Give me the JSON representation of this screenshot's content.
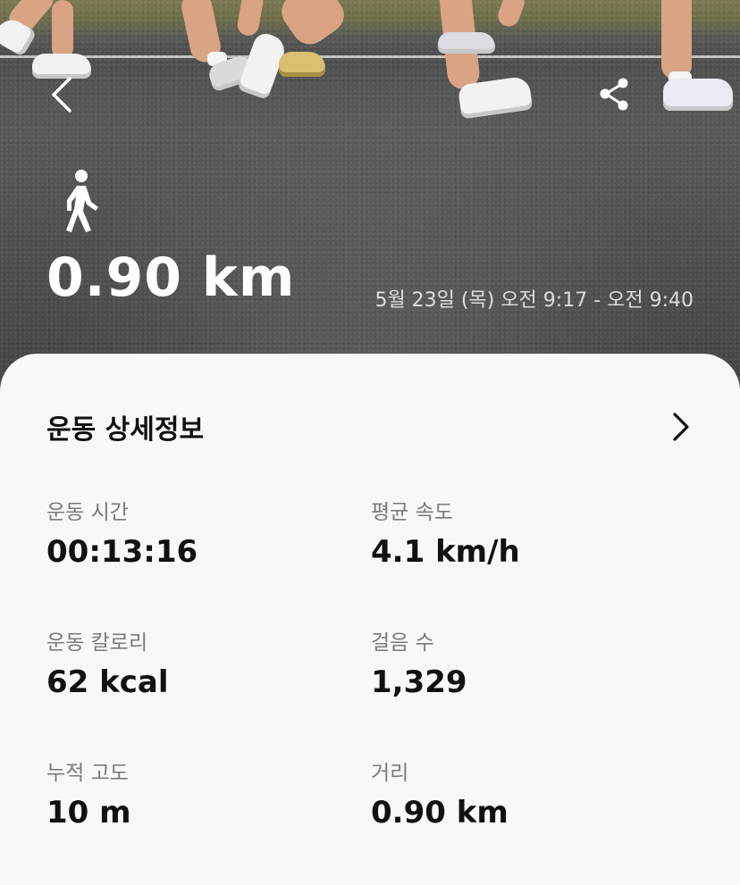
{
  "hero": {
    "distance": "0.90 km",
    "date_range": "5월 23일 (목) 오전 9:17 - 오전 9:40",
    "back_icon": "chevron-left-icon",
    "share_icon": "share-icon",
    "activity_icon": "walking-person-icon"
  },
  "details": {
    "title": "운동 상세정보",
    "more_icon": "chevron-right-icon",
    "stats": [
      {
        "label": "운동 시간",
        "value": "00:13:16"
      },
      {
        "label": "평균 속도",
        "value": "4.1 km/h"
      },
      {
        "label": "운동 칼로리",
        "value": "62 kcal"
      },
      {
        "label": "걸음 수",
        "value": "1,329"
      },
      {
        "label": "누적 고도",
        "value": "10 m"
      },
      {
        "label": "거리",
        "value": "0.90 km"
      }
    ]
  },
  "colors": {
    "card_background": "#f8f8fa",
    "text_primary": "#111111",
    "text_secondary": "#7a7a7a",
    "hero_text": "#ffffff"
  }
}
